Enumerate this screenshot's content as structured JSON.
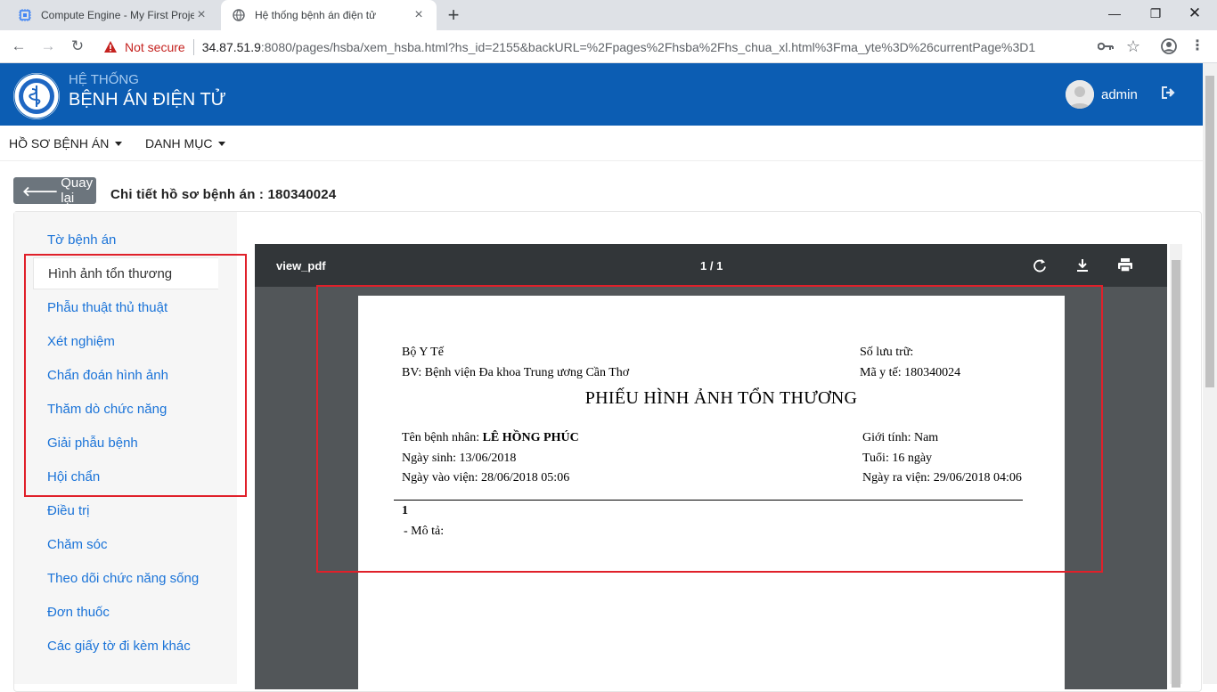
{
  "browser": {
    "tabs": [
      {
        "title": "Compute Engine - My First Project"
      },
      {
        "title": "Hệ thống bệnh án điện tử"
      }
    ],
    "address": {
      "security": "Not secure",
      "host": "34.87.51.9",
      "rest": ":8080/pages/hsba/xem_hsba.html?hs_id=2155&backURL=%2Fpages%2Fhsba%2Fhs_chua_xl.html%3Fma_yte%3D%26currentPage%3D1"
    }
  },
  "header": {
    "brand_top": "HỆ THỐNG",
    "brand_main": "BỆNH ÁN ĐIỆN TỬ",
    "user": "admin"
  },
  "menu": {
    "items": [
      {
        "label": "HỒ SƠ BỆNH ÁN"
      },
      {
        "label": "DANH MỤC"
      }
    ]
  },
  "page": {
    "back_label": "Quay lại",
    "title": "Chi tiết hồ sơ bệnh án : 180340024"
  },
  "sidebar": {
    "items": [
      {
        "label": "Tờ bệnh án"
      },
      {
        "label": "Hình ảnh tổn thương"
      },
      {
        "label": "Phẫu thuật thủ thuật"
      },
      {
        "label": "Xét nghiệm"
      },
      {
        "label": "Chẩn đoán hình ảnh"
      },
      {
        "label": "Thăm dò chức năng"
      },
      {
        "label": "Giải phẫu bệnh"
      },
      {
        "label": "Hội chẩn"
      },
      {
        "label": "Điều trị"
      },
      {
        "label": "Chăm sóc"
      },
      {
        "label": "Theo dõi chức năng sống"
      },
      {
        "label": "Đơn thuốc"
      },
      {
        "label": "Các giấy tờ đi kèm khác"
      }
    ],
    "active_index": 1
  },
  "pdf": {
    "name": "view_pdf",
    "pages": "1 / 1",
    "doc": {
      "ministry": "Bộ Y Tế",
      "hospital": "BV: Bệnh viện Đa khoa Trung ương Cần Thơ",
      "archive_label": "Số lưu trữ:",
      "health_id": "Mã y tế: 180340024",
      "title": "PHIẾU HÌNH ẢNH TỔN THƯƠNG",
      "patient_label": "Tên bệnh nhân:",
      "patient_name": "LÊ HỒNG PHÚC",
      "dob": "Ngày sinh:  13/06/2018",
      "admitted": "Ngày vào viện: 28/06/2018 05:06",
      "gender": "Giới tính:  Nam",
      "age": "Tuổi: 16 ngày",
      "discharged": "Ngày ra viện: 29/06/2018 04:06",
      "item_no": "1",
      "description": "- Mô tả:"
    }
  },
  "colors": {
    "header_blue": "#0c5db3",
    "link_blue": "#1a73d8",
    "highlight_red": "#e0202a",
    "back_button_gray": "#6c757d"
  }
}
